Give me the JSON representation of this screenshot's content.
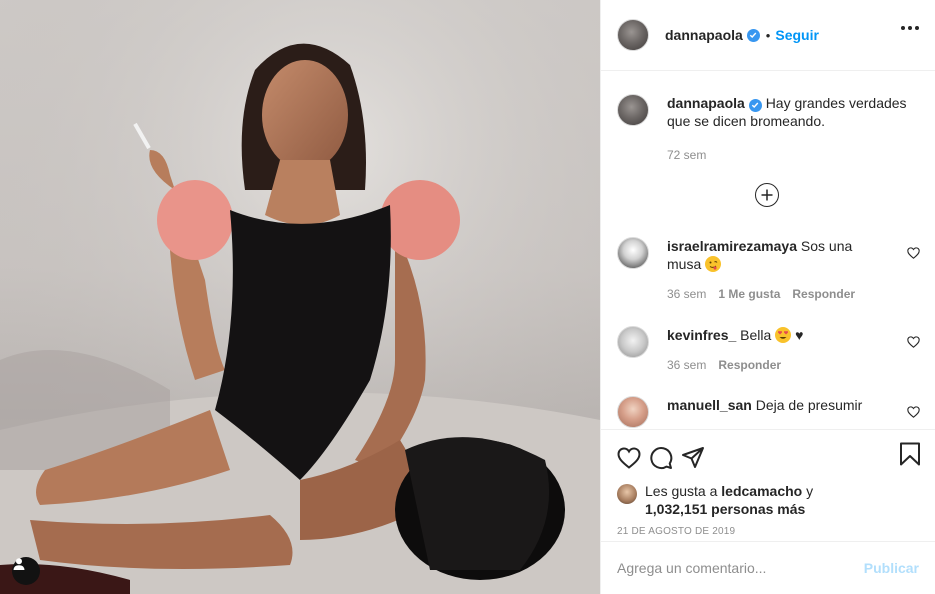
{
  "header": {
    "username": "dannapaola",
    "separator": "•",
    "follow_label": "Seguir",
    "more_icon": "more-horizontal-icon"
  },
  "caption": {
    "username": "dannapaola",
    "text": "Hay grandes verdades que se dicen bromeando.",
    "time": "72 sem"
  },
  "comments": [
    {
      "username": "israelramirezamaya",
      "text": "Sos una musa",
      "emoji": "savoring-food-face-emoji",
      "time": "36 sem",
      "likes": "1 Me gusta",
      "reply": "Responder"
    },
    {
      "username": "kevinfres_",
      "text": "Bella",
      "emoji": "heart-eyes-face-emoji",
      "suffix": "♥",
      "time": "36 sem",
      "reply": "Responder"
    },
    {
      "username": "manuell_san",
      "text": "Deja de presumir"
    }
  ],
  "actions": {
    "like_icon": "heart-icon",
    "comment_icon": "comment-icon",
    "share_icon": "share-icon",
    "save_icon": "bookmark-icon"
  },
  "likes": {
    "prefix": "Les gusta a",
    "user": "ledcamacho",
    "joiner": "y",
    "count": "1,032,151 personas más"
  },
  "date": "21 DE AGOSTO DE 2019",
  "add_comment": {
    "placeholder": "Agrega un comentario...",
    "publish_label": "Publicar"
  },
  "colors": {
    "link_blue": "#0095f6",
    "publish_disabled": "#b2dffc",
    "verified_blue": "#3897f0",
    "muted_text": "#8e8e8e",
    "border": "#efefef"
  }
}
